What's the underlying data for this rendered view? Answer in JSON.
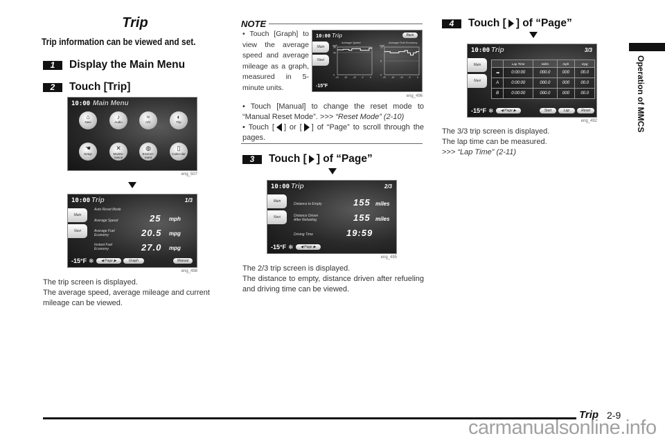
{
  "page": {
    "title": "Trip",
    "subtitle": "Trip information can be viewed and set.",
    "side_tab": "Operation of MMCS",
    "footer_section": "Trip",
    "footer_page": "2-9",
    "watermark": "carmanualsonline.info"
  },
  "steps": [
    {
      "num": "1",
      "label": "Display the Main Menu"
    },
    {
      "num": "2",
      "label": "Touch [Trip]"
    },
    {
      "num": "3",
      "label_pre": "Touch [",
      "label_post": "] of “Page”"
    },
    {
      "num": "4",
      "label_pre": "Touch [",
      "label_post": "] of “Page”"
    }
  ],
  "main_menu_screen": {
    "time": "10:00",
    "title": "Main Menu",
    "caption": "eng_507",
    "buttons": [
      {
        "label": "Navi",
        "icon": "home-icon"
      },
      {
        "label": "Audio",
        "icon": "speaker-icon"
      },
      {
        "label": "A/C",
        "icon": "air-flow-icon"
      },
      {
        "label": "Trip",
        "icon": "fuel-icon"
      },
      {
        "label": "Setup",
        "icon": "hand-icon"
      },
      {
        "label": "Mainte-nance",
        "icon": "tools-icon"
      },
      {
        "label": "Environ-ment",
        "icon": "globe-icon"
      },
      {
        "label": "Calen-dar",
        "icon": "calendar-icon"
      }
    ]
  },
  "trip1_screen": {
    "time": "10:00",
    "title": "Trip",
    "page": "1/3",
    "caption": "eng_498",
    "side": [
      "Main",
      "Navi"
    ],
    "mode": "Auto Reset Mode",
    "rows": [
      {
        "label": "Average Speed",
        "value": "25",
        "unit": "mph"
      },
      {
        "label": "Average Fuel Economy",
        "value": "20.5",
        "unit": "mpg"
      },
      {
        "label": "Instant Fuel Economy",
        "value": "27.0",
        "unit": "mpg"
      }
    ],
    "temp": "-15°F",
    "page_btn": "Page",
    "graph_btn": "Graph",
    "manual_btn": "Manual"
  },
  "trip1_desc": [
    "The trip screen is displayed.",
    "The average speed, average mileage and current mileage can be viewed."
  ],
  "note": {
    "heading": "NOTE",
    "bullets": [
      {
        "text": "Touch [Graph] to view the average speed and average mileage as a graph, measured in 5-minute units."
      },
      {
        "text": "Touch [Manual] to change the reset mode to “Manual Reset Mode”. ",
        "ref": ">>> “Reset Mode” (2-10)"
      },
      {
        "pre": "Touch [",
        "mid": "] or [",
        "post": "] of “Page” to scroll through the pages."
      }
    ]
  },
  "graph_screen": {
    "time": "10:00",
    "title": "Trip",
    "back_btn": "Back",
    "caption": "eng_496",
    "side": [
      "Main",
      "Navi"
    ],
    "temp": "-15°F",
    "graph1_title": "Average Speed",
    "graph2_title": "Average Fuel Economy"
  },
  "chart_data": [
    {
      "type": "line",
      "title": "Average Speed",
      "ylabel": "mph",
      "yticks": [
        "0",
        "40",
        "50"
      ],
      "ylim": [
        0,
        50
      ],
      "x": [
        "-20",
        "-15",
        "-10",
        "-5",
        "0"
      ],
      "values": [
        45,
        45,
        46,
        46,
        44,
        47,
        47,
        47,
        44,
        44,
        44,
        48
      ]
    },
    {
      "type": "line",
      "title": "Average Fuel Economy",
      "ylabel": "mpg",
      "yticks": [
        "0",
        "6",
        "12"
      ],
      "ylim": [
        0,
        12
      ],
      "x": [
        "-20",
        "-15",
        "-10",
        "-5",
        "0"
      ],
      "values": [
        10,
        10,
        9.5,
        9.5,
        9.5,
        10,
        10,
        10.5,
        9.5,
        8.5,
        9.5,
        10
      ]
    }
  ],
  "trip2_screen": {
    "time": "10:00",
    "title": "Trip",
    "page": "2/3",
    "caption": "eng_495",
    "side": [
      "Main",
      "Navi"
    ],
    "rows": [
      {
        "label": "Distance to Empty",
        "value": "155",
        "unit": "miles"
      },
      {
        "label": "Distance Driven After Refueling",
        "value": "155",
        "unit": "miles"
      },
      {
        "label": "Driving Time",
        "value": "19:59",
        "unit": ""
      }
    ],
    "temp": "-15°F",
    "page_btn": "Page"
  },
  "trip2_desc": [
    "The 2/3 trip screen is displayed.",
    "The distance to empty, distance driven after refueling and driving time can be viewed."
  ],
  "trip3_screen": {
    "time": "10:00",
    "title": "Trip",
    "page": "3/3",
    "caption": "eng_492",
    "side": [
      "Main",
      "Navi"
    ],
    "headers": [
      "",
      "Lap Time",
      "miles",
      "mph",
      "mpg"
    ],
    "rows": [
      [
        "➡",
        "0:00:00",
        "000.0",
        "000",
        "00.0"
      ],
      [
        "A",
        "0:00:00",
        "000.0",
        "000",
        "00.0"
      ],
      [
        "B",
        "0:00:00",
        "000.0",
        "000",
        "00.0"
      ]
    ],
    "temp": "-15°F",
    "page_btn": "Page",
    "start_btn": "Start",
    "lap_btn": "Lap",
    "reset_btn": "Reset"
  },
  "trip3_desc": [
    "The 3/3 trip screen is displayed.",
    "The lap time can be measured.",
    ">>> “Lap Time” (2-11)"
  ]
}
